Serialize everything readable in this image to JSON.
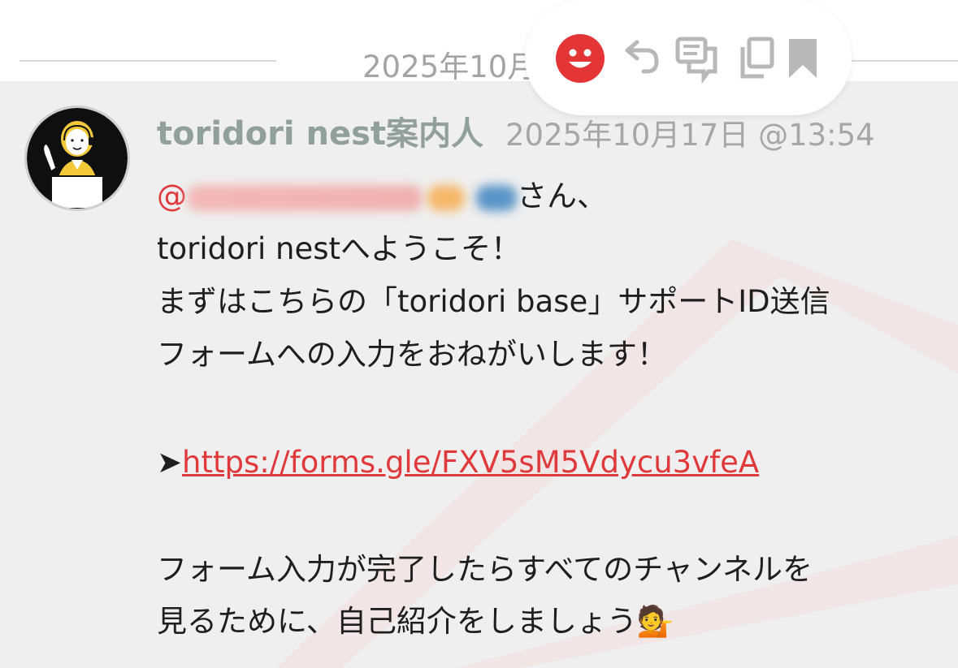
{
  "date_divider": {
    "text": "2025年10月"
  },
  "message": {
    "author": "toridori nest案内人",
    "timestamp": "2025年10月17日 @13:54",
    "mention_at": "@",
    "mention_suffix": "さん、",
    "lines": [
      "toridori nestへようこそ！",
      "まずはこちらの「toridori base」サポートID送信",
      "フォームへの入力をおねがいします！"
    ],
    "link_arrow": "➤",
    "link_url": "https://forms.gle/FXV5sM5Vdycu3vfeA",
    "closing_lines": [
      "フォーム入力が完了したらすべてのチャンネルを",
      "見るために、自己紹介をしましょう"
    ],
    "closing_emoji": "💁"
  },
  "toolbar": {
    "icons": [
      "reaction-smiley-icon",
      "reply-icon",
      "thread-icon",
      "copy-icon",
      "bookmark-icon"
    ]
  },
  "colors": {
    "accent": "#e0393b",
    "author": "#92a09b",
    "background": "#efefef"
  }
}
